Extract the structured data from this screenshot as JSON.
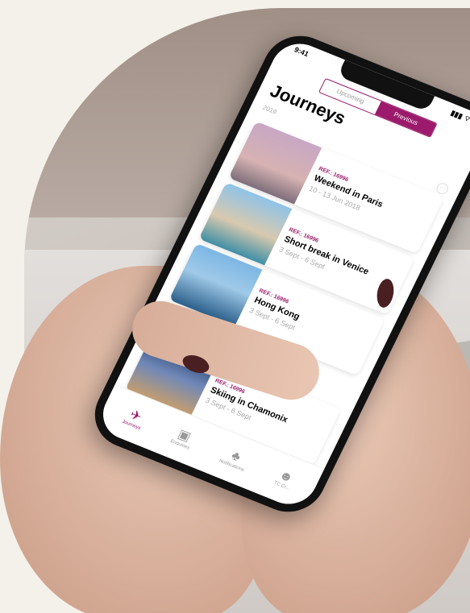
{
  "status": {
    "time": "9:41",
    "indicators": "▮▮▮ ⌔ ▭"
  },
  "segments": {
    "upcoming": "Upcoming",
    "previous": "Previous",
    "selected": "Previous"
  },
  "title": "Journeys",
  "year": "2019",
  "more_label": "···",
  "journeys": [
    {
      "ref": "REF.: 16996",
      "name": "Weekend in Paris",
      "dates": "10 - 13 Jun 2018",
      "image": "eiffel-tower-photo"
    },
    {
      "ref": "REF.: 16996",
      "name": "Short break in Venice",
      "dates": "3 Sept - 6 Sept",
      "image": "venice-gondola-photo"
    },
    {
      "ref": "REF.: 16996",
      "name": "Hong Kong",
      "dates": "3 Sept - 6 Sept",
      "image": "hong-kong-harbour-photo"
    },
    {
      "ref": "REF.: 16996",
      "name": "Skiing in Chamonix",
      "dates": "3 Sept - 6 Sept",
      "image": "chamonix-night-photo"
    }
  ],
  "tabs": [
    {
      "label": "Journeys",
      "icon": "plane-icon",
      "glyph": "✈",
      "active": true
    },
    {
      "label": "Enquiries",
      "icon": "suitcase-icon",
      "glyph": "▣",
      "active": false
    },
    {
      "label": "Notifications",
      "icon": "bell-icon",
      "glyph": "♣",
      "active": false
    },
    {
      "label": "TC Cr...",
      "icon": "people-icon",
      "glyph": "☻",
      "active": false
    }
  ],
  "colors": {
    "accent": "#9b1a6b",
    "background": "#f4f1ea"
  }
}
